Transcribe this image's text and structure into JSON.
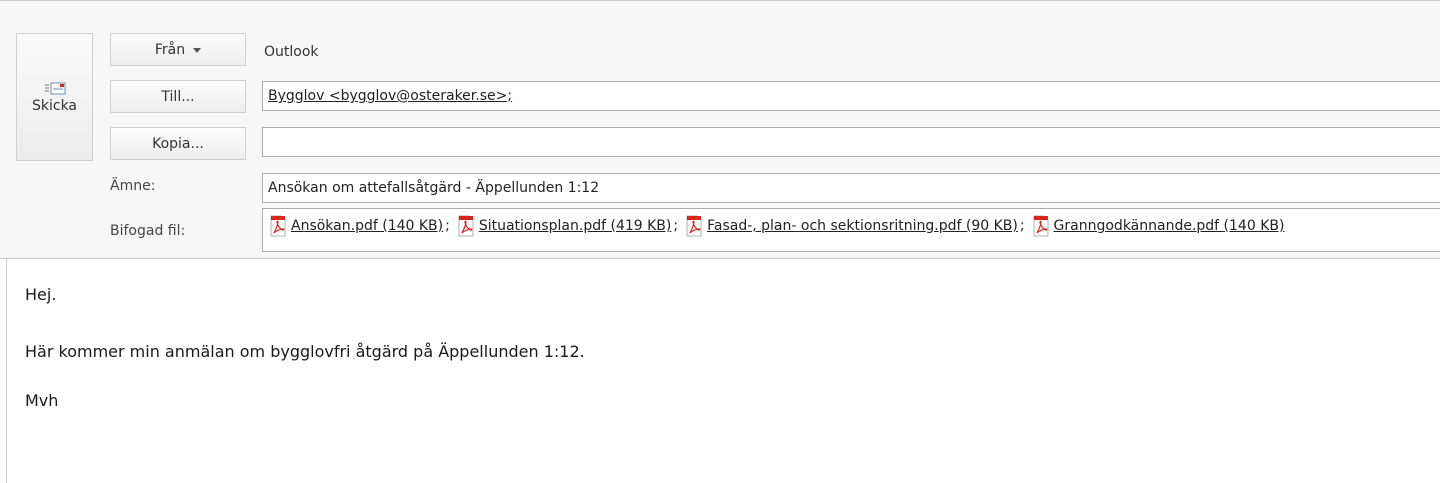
{
  "compose": {
    "send_label": "Skicka",
    "from_label": "Från",
    "from_value": "Outlook",
    "to_label": "Till...",
    "to_value": "Bygglov <bygglov@osteraker.se>;",
    "cc_label": "Kopia...",
    "cc_value": "",
    "subject_label": "Ämne:",
    "subject_value": "Ansökan om attefallsåtgärd - Äppellunden 1:12",
    "attachments_label": "Bifogad fil:",
    "attachments": [
      {
        "name": "Ansökan.pdf (140 KB)",
        "icon": "pdf-icon"
      },
      {
        "name": "Situationsplan.pdf (419 KB)",
        "icon": "pdf-icon"
      },
      {
        "name": "Fasad-, plan- och sektionsritning.pdf (90 KB)",
        "icon": "pdf-icon"
      },
      {
        "name": "Granngodkännande.pdf (140 KB)",
        "icon": "pdf-icon"
      }
    ],
    "separator": ";"
  },
  "body": {
    "lines": [
      "Hej.",
      "Här kommer min anmälan om bygglovfri åtgärd på Äppellunden 1:12.",
      "Mvh"
    ]
  },
  "colors": {
    "header_bg": "#f7f7f7",
    "pdf_red": "#d9261c"
  }
}
